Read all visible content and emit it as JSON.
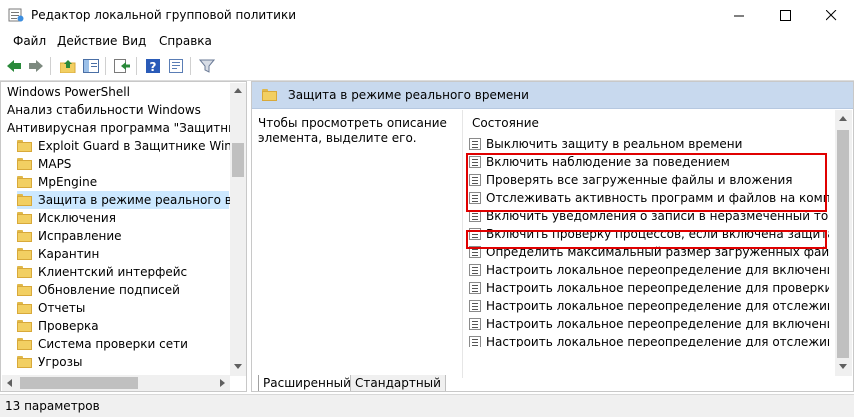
{
  "window": {
    "title": "Редактор локальной групповой политики",
    "icon": "group-policy-editor-icon",
    "buttons": [
      "minimize-icon",
      "maximize-icon",
      "close-icon"
    ]
  },
  "menu": [
    "Файл",
    "Действие",
    "Вид",
    "Справка"
  ],
  "toolbar": [
    "back-icon",
    "forward-icon",
    "up-folder-icon",
    "show-hide-tree-icon",
    "export-list-icon",
    "help-icon",
    "properties-icon",
    "filter-icon"
  ],
  "tree": {
    "items": [
      {
        "label": "Windows PowerShell",
        "level": 0
      },
      {
        "label": "Анализ стабильности Windows",
        "level": 0
      },
      {
        "label": "Антивирусная программа \"Защитник",
        "level": 0
      },
      {
        "label": "Exploit Guard в Защитнике Window",
        "level": 1
      },
      {
        "label": "MAPS",
        "level": 1
      },
      {
        "label": "MpEngine",
        "level": 1
      },
      {
        "label": "Защита в режиме реального врем",
        "level": 1,
        "selected": true
      },
      {
        "label": "Исключения",
        "level": 1
      },
      {
        "label": "Исправление",
        "level": 1
      },
      {
        "label": "Карантин",
        "level": 1
      },
      {
        "label": "Клиентский интерфейс",
        "level": 1
      },
      {
        "label": "Обновление подписей",
        "level": 1
      },
      {
        "label": "Отчеты",
        "level": 1
      },
      {
        "label": "Проверка",
        "level": 1
      },
      {
        "label": "Система проверки сети",
        "level": 1
      },
      {
        "label": "Угрозы",
        "level": 1
      }
    ]
  },
  "right": {
    "header": "Защита в режиме реального времени",
    "description": "Чтобы просмотреть описание элемента, выделите его.",
    "column_header": "Состояние",
    "policies": [
      "Выключить защиту в реальном времени",
      "Включить наблюдение за поведением",
      "Проверять все загруженные файлы и вложения",
      "Отслеживать активность программ и файлов на компью...",
      "Включить уведомления о записи в неразмеченный том",
      "Включить проверку процессов, если включена защита в ...",
      "Определить максимальный размер загруженных файлов...",
      "Настроить локальное переопределение для включения к...",
      "Настроить локальное переопределение для проверки вс...",
      "Настроить локальное переопределение для отслеживан...",
      "Настроить локальное переопределение для включения з...",
      "Настроить локальное переопределение для отслеживан..."
    ]
  },
  "tabs": [
    "Расширенный",
    "Стандартный"
  ],
  "highlight_color": "#e00000",
  "status": "13 параметров"
}
